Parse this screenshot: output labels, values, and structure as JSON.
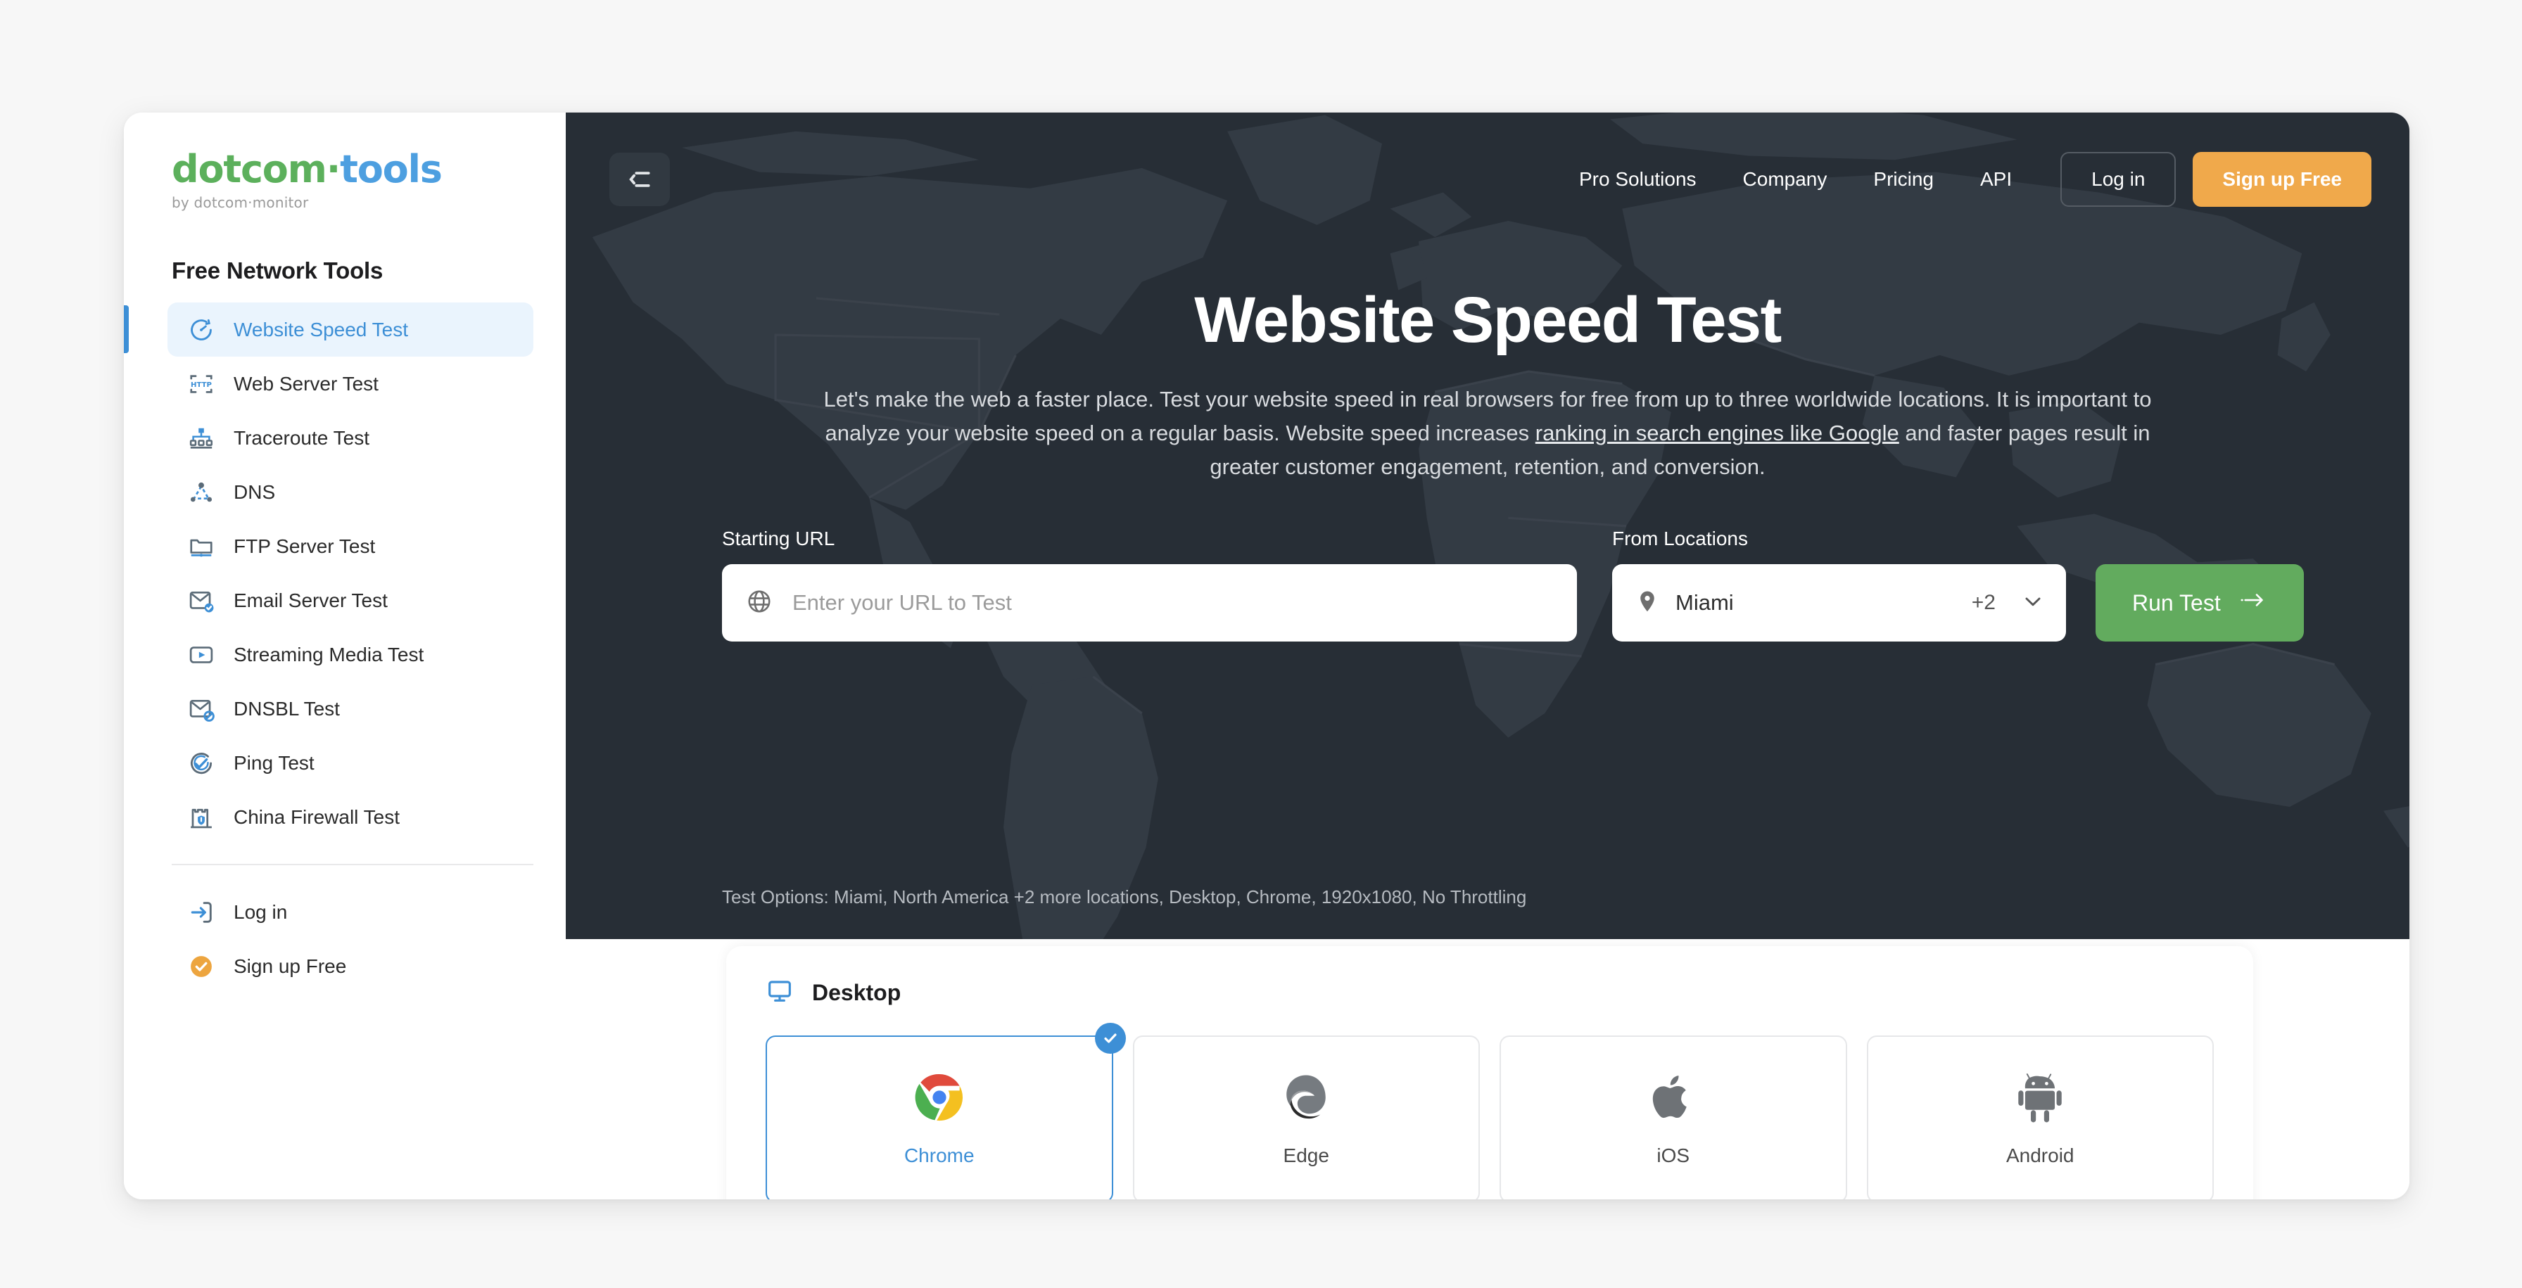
{
  "brand": {
    "logo_part1": "dotcom",
    "logo_dot": "·",
    "logo_part2": "tools",
    "logo_tagline": "by dotcom·monitor"
  },
  "sidebar": {
    "section_title": "Free Network Tools",
    "items": [
      {
        "label": "Website Speed Test",
        "icon": "speedometer-icon",
        "active": true
      },
      {
        "label": "Web Server Test",
        "icon": "http-icon",
        "active": false
      },
      {
        "label": "Traceroute Test",
        "icon": "traceroute-icon",
        "active": false
      },
      {
        "label": "DNS",
        "icon": "dns-icon",
        "active": false
      },
      {
        "label": "FTP Server Test",
        "icon": "ftp-folder-icon",
        "active": false
      },
      {
        "label": "Email Server Test",
        "icon": "email-check-icon",
        "active": false
      },
      {
        "label": "Streaming Media Test",
        "icon": "play-video-icon",
        "active": false
      },
      {
        "label": "DNSBL Test",
        "icon": "email-block-icon",
        "active": false
      },
      {
        "label": "Ping Test",
        "icon": "ping-icon",
        "active": false
      },
      {
        "label": "China Firewall Test",
        "icon": "firewall-tower-icon",
        "active": false
      }
    ],
    "bottom_items": [
      {
        "label": "Log in",
        "icon": "login-arrow-icon"
      },
      {
        "label": "Sign up Free",
        "icon": "check-circle-icon"
      }
    ]
  },
  "topnav": {
    "collapse_icon": "collapse-sidebar-icon",
    "links": [
      "Pro Solutions",
      "Company",
      "Pricing",
      "API"
    ],
    "login_label": "Log in",
    "signup_label": "Sign up Free"
  },
  "hero": {
    "title": "Website Speed Test",
    "sub_part1": "Let's make the web a faster place. Test your website speed in real browsers for free from up to three worldwide locations. It is important to analyze your website speed on a regular basis. Website speed increases ",
    "sub_link": "ranking in search engines like Google",
    "sub_part2": " and faster pages result in greater customer engagement, retention, and conversion."
  },
  "form": {
    "url_label": "Starting URL",
    "url_placeholder": "Enter your URL to Test",
    "url_value": "",
    "url_icon": "globe-icon",
    "locations_label": "From Locations",
    "location_selected": "Miami",
    "location_more": "+2",
    "location_icon": "map-pin-icon",
    "chevron_icon": "chevron-down-icon",
    "run_label": "Run Test",
    "run_icon": "arrow-right-icon",
    "test_options": "Test Options: Miami, North America +2 more locations, Desktop, Chrome, 1920x1080, No Throttling"
  },
  "devices": {
    "head_label": "Desktop",
    "head_icon": "monitor-icon",
    "browsers": [
      {
        "label": "Chrome",
        "icon": "chrome-icon",
        "selected": true
      },
      {
        "label": "Edge",
        "icon": "edge-icon",
        "selected": false
      },
      {
        "label": "iOS",
        "icon": "apple-icon",
        "selected": false
      },
      {
        "label": "Android",
        "icon": "android-icon",
        "selected": false
      }
    ]
  },
  "colors": {
    "hero_bg": "#272e36",
    "accent_blue": "#3d8fd6",
    "accent_orange": "#f0a94b",
    "accent_green": "#62ab5e",
    "logo_green": "#5cb05c"
  }
}
